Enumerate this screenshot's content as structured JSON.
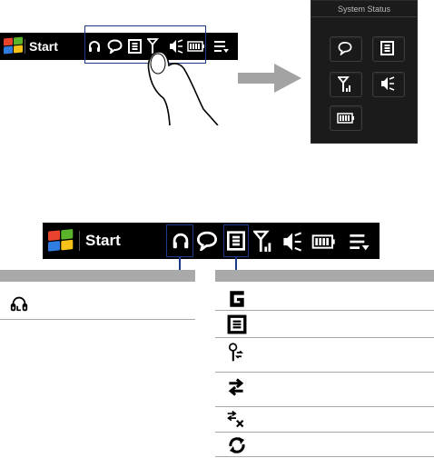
{
  "top_bar": {
    "start_label": "Start"
  },
  "system_status": {
    "title": "System Status"
  },
  "bottom_bar": {
    "start_label": "Start"
  },
  "tables": {
    "left": {
      "header": "",
      "rows": [
        {
          "icon": "headphones-icon",
          "text": ""
        }
      ]
    },
    "right": {
      "header": "",
      "rows": [
        {
          "icon": "g-icon",
          "text": ""
        },
        {
          "icon": "e-icon",
          "text": ""
        },
        {
          "icon": "connecting-antenna-icon",
          "text": ""
        },
        {
          "icon": "data-transfer-icon",
          "text": ""
        },
        {
          "icon": "data-disconnected-icon",
          "text": ""
        },
        {
          "icon": "sync-icon",
          "text": ""
        }
      ]
    }
  },
  "colors": {
    "bar": "#000000",
    "panel": "#1b1b1b",
    "callout": "#1c3a8a",
    "table_header": "#a9a9a9",
    "arrow": "#a3a3a3"
  }
}
